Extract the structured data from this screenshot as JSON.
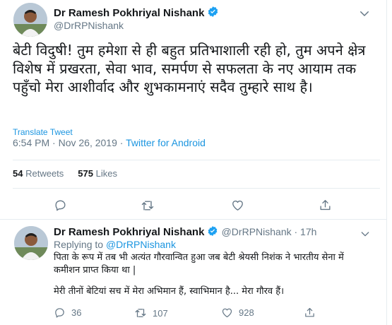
{
  "tweet": {
    "author_name": "Dr Ramesh Pokhriyal Nishank",
    "author_handle": "@DrRPNishank",
    "text": "बेटी विदुषी! तुम हमेशा से ही बहुत प्रतिभाशाली रही हो, तुम अपने क्षेत्र विशेष में प्रखरता, सेवा भाव, समर्पण से सफलता के नए आयाम तक पहुँचो मेरा आशीर्वाद और शुभकामनाएं सदैव तुम्हारे साथ है।",
    "translate_label": "Translate Tweet",
    "time": "6:54 PM · Nov 26, 2019 · ",
    "source": "Twitter for Android",
    "retweets_count": "54",
    "retweets_label": "Retweets",
    "likes_count": "575",
    "likes_label": "Likes"
  },
  "reply": {
    "author_name": "Dr Ramesh Pokhriyal Nishank",
    "author_handle": "@DrRPNishank · 17h",
    "replying_prefix": "Replying to ",
    "replying_handle": "@DrRPNishank",
    "text_line1": "पिता के रूप में तब भी अत्यंत गौरवान्वित हुआ जब बेटी श्रेयसी निशंक ने भारतीय सेना में",
    "text_line2": "कमीशन प्राप्त किया था |",
    "text_line3": "मेरी तीनों बेटियां सच में मेरा अभिमान हैं, स्वाभिमान है... मेरा गौरव हैं।",
    "reply_count": "36",
    "retweet_count": "107",
    "like_count": "928"
  },
  "colors": {
    "accent": "#1b95e0",
    "secondary_text": "#657786",
    "verified": "#1da1f2"
  },
  "icons": [
    "verified-badge-icon",
    "chevron-down-icon",
    "reply-icon",
    "retweet-icon",
    "like-icon",
    "share-icon"
  ]
}
